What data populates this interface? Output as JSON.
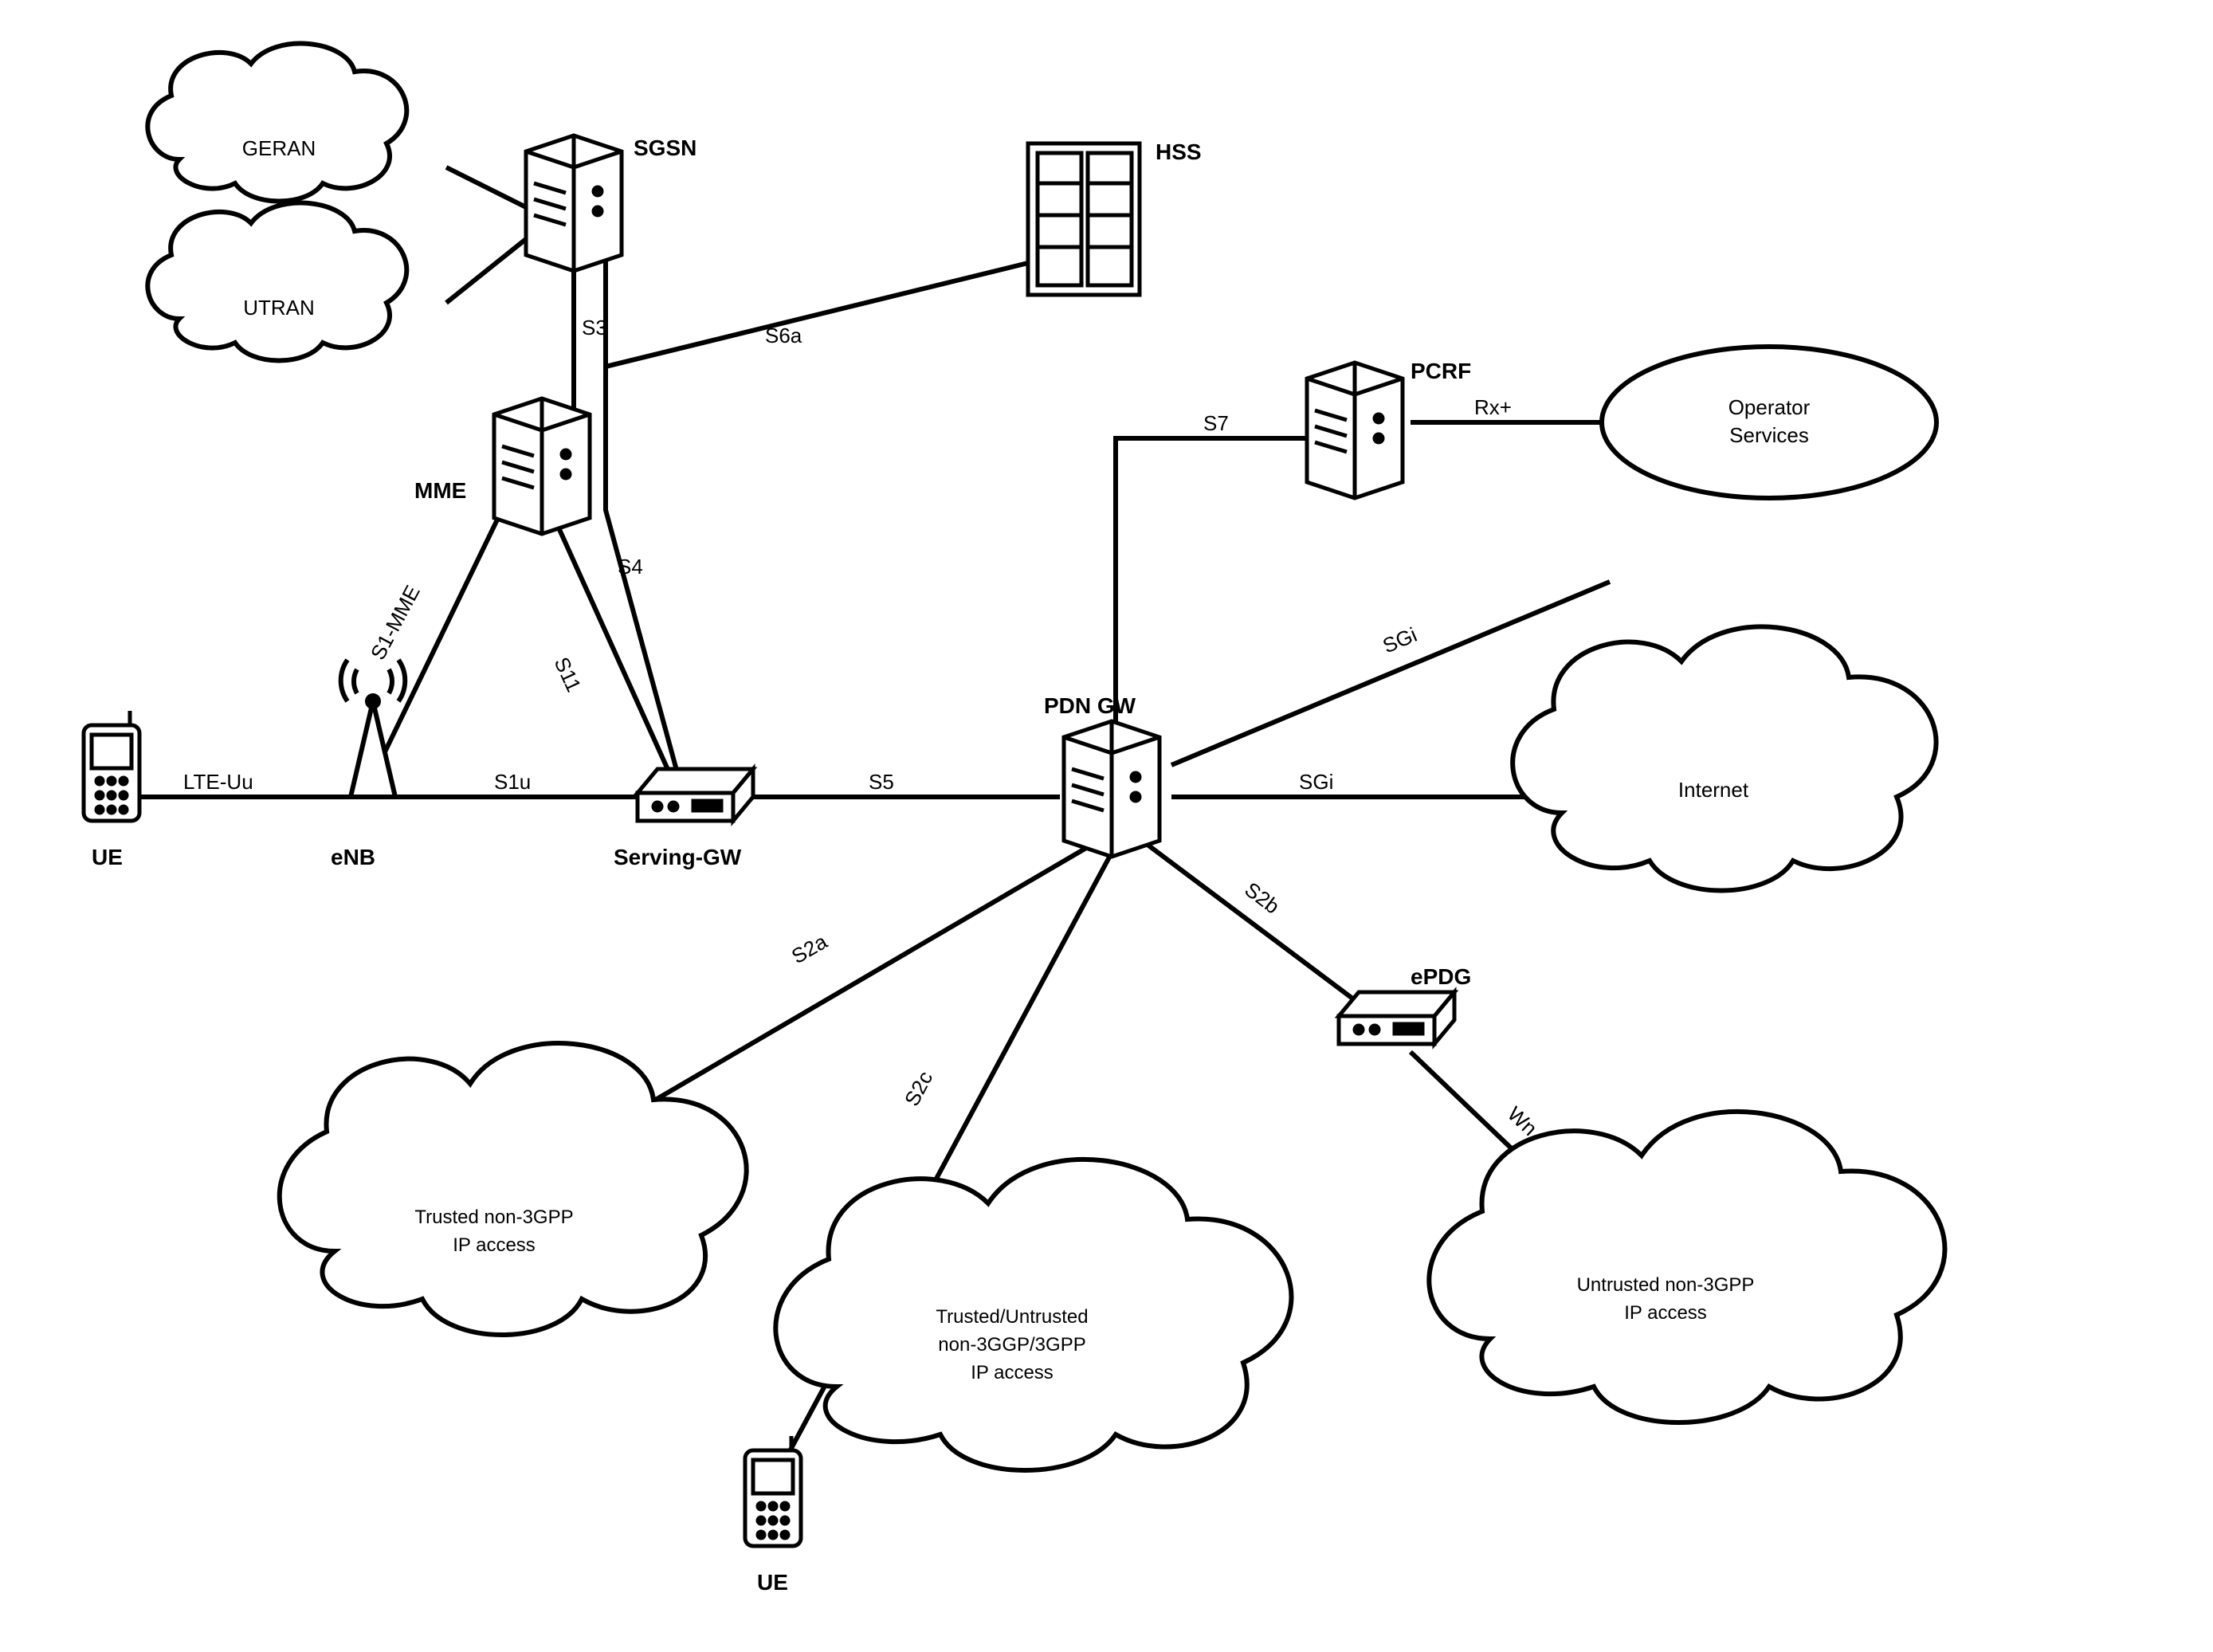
{
  "nodes": {
    "ue1": "UE",
    "ue2": "UE",
    "enb": "eNB",
    "sgsn": "SGSN",
    "mme": "MME",
    "hss": "HSS",
    "sgw": "Serving-GW",
    "pgw": "PDN GW",
    "pcrf": "PCRF",
    "epdg": "ePDG",
    "geran": "GERAN",
    "utran": "UTRAN",
    "opserv_l1": "Operator",
    "opserv_l2": "Services",
    "internet": "Internet",
    "trusted_l1": "Trusted non-3GPP",
    "trusted_l2": "IP access",
    "mixed_l1": "Trusted/Untrusted",
    "mixed_l2": "non-3GGP/3GPP",
    "mixed_l3": "IP access",
    "untrusted_l1": "Untrusted non-3GPP",
    "untrusted_l2": "IP access"
  },
  "links": {
    "lteuu": "LTE-Uu",
    "s1mme": "S1-MME",
    "s1u": "S1u",
    "s3": "S3",
    "s4": "S4",
    "s11": "S11",
    "s5": "S5",
    "s6a": "S6a",
    "s7": "S7",
    "rxp": "Rx+",
    "sgi1": "SGi",
    "sgi2": "SGi",
    "s2a": "S2a",
    "s2b": "S2b",
    "s2c": "S2c",
    "wn": "Wn"
  }
}
